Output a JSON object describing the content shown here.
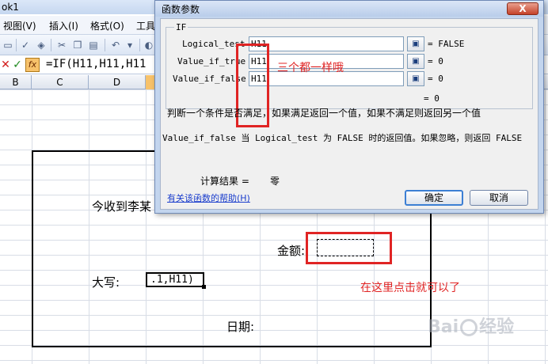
{
  "window": {
    "title_fragment": "ok1"
  },
  "menu": {
    "items": [
      "视图(V)",
      "插入(I)",
      "格式(O)",
      "工具"
    ]
  },
  "formula_bar": {
    "formula": "=IF(H11,H11,H11"
  },
  "column_headers": [
    "B",
    "C",
    "D"
  ],
  "sheet": {
    "text_received": "今收到李某",
    "label_amount": "金额:",
    "label_uppercase": "大写:",
    "active_cell_text": ".1,H11)",
    "label_date": "日期:",
    "annotation_click_here": "在这里点击就可以了"
  },
  "dialog": {
    "title": "函数参数",
    "close_label": "X",
    "function_name": "IF",
    "args": [
      {
        "label": "Logical_test",
        "value": "H11",
        "result": "= FALSE"
      },
      {
        "label": "Value_if_true",
        "value": "H11",
        "result": "= 0"
      },
      {
        "label": "Value_if_false",
        "value": "H11",
        "result": "= 0"
      }
    ],
    "overall_result": "=  0",
    "description": "判断一个条件是否满足，如果满足返回一个值，如果不满足则返回另一个值",
    "arg_description": "Value_if_false   当 Logical_test 为 FALSE 时的返回值。如果忽略，则返回 FALSE",
    "calc_result_label": "计算结果 =",
    "calc_result_value": "零",
    "help_link": "有关该函数的帮助(H)",
    "ok_label": "确定",
    "cancel_label": "取消",
    "annotation_same": "三个都一样哦"
  },
  "watermark": {
    "text_left": "Bai",
    "text_right": "经验"
  },
  "colors": {
    "annotation_red": "#e02424",
    "dialog_bg": "#c3d5ee"
  }
}
